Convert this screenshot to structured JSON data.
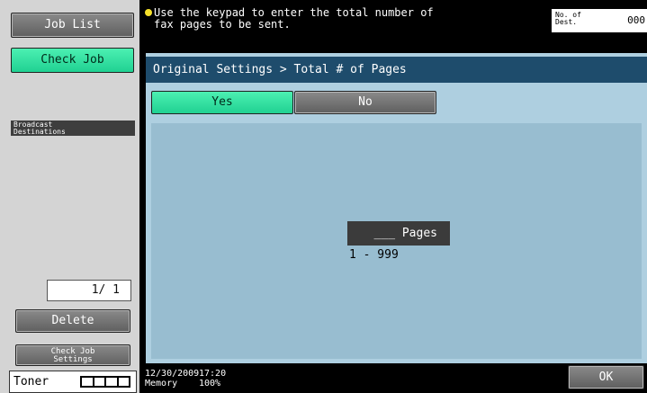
{
  "sidebar": {
    "job_list": "Job List",
    "check_job": "Check Job",
    "broadcast_label": "Broadcast\nDestinations",
    "counter": "1/  1",
    "delete": "Delete",
    "check_job_settings": "Check Job\nSettings",
    "toner_label": "Toner",
    "toner_level": 1.0
  },
  "header": {
    "message": "Use the keypad to enter the total number of\nfax pages to be sent.",
    "dest_label": "No. of\nDest.",
    "dest_value": "000"
  },
  "panel": {
    "breadcrumb": "Original Settings > Total # of Pages",
    "yes_label": "Yes",
    "no_label": "No",
    "pages_value": "___ Pages",
    "range": "1  -  999"
  },
  "footer": {
    "date": "12/30/2009",
    "time": "17:20",
    "memory_label": "Memory",
    "memory_value": "100%",
    "ok_label": "OK"
  },
  "colors": {
    "accent_green": "#2fe3a2",
    "header_blue": "#1e4c6c",
    "panel_bg": "#aecfe0"
  }
}
